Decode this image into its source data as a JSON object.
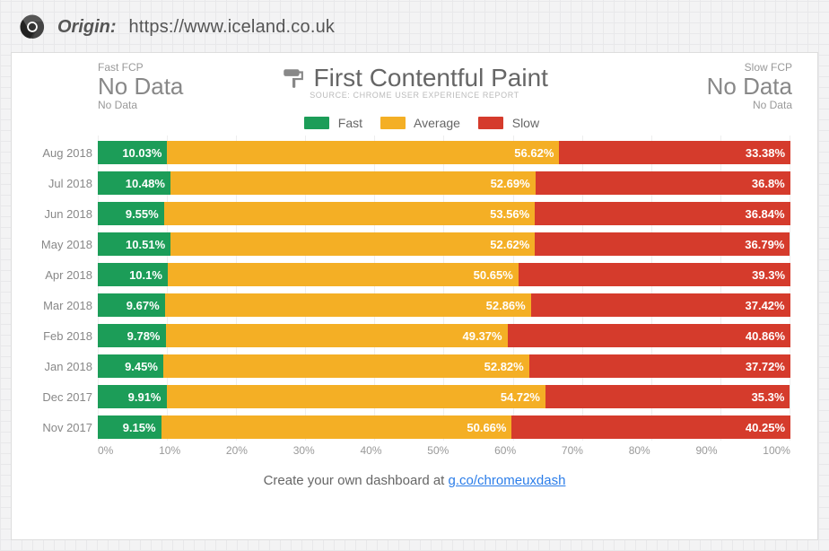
{
  "header": {
    "origin_label": "Origin:",
    "origin_url": "https://www.iceland.co.uk"
  },
  "summary": {
    "fast_label": "Fast FCP",
    "fast_value": "No Data",
    "fast_sub": "No Data",
    "slow_label": "Slow FCP",
    "slow_value": "No Data",
    "slow_sub": "No Data"
  },
  "chart": {
    "title": "First Contentful Paint",
    "source": "SOURCE: CHROME USER EXPERIENCE REPORT",
    "legend": {
      "fast": "Fast",
      "avg": "Average",
      "slow": "Slow"
    }
  },
  "axis": {
    "ticks": [
      "0%",
      "10%",
      "20%",
      "30%",
      "40%",
      "50%",
      "60%",
      "70%",
      "80%",
      "90%",
      "100%"
    ]
  },
  "footer": {
    "text": "Create your own dashboard at ",
    "link_text": "g.co/chromeuxdash"
  },
  "colors": {
    "fast": "#1c9d58",
    "avg": "#f4af25",
    "slow": "#d53b2c"
  },
  "chart_data": {
    "type": "bar",
    "orientation": "horizontal",
    "stacked": true,
    "xlim": [
      0,
      100
    ],
    "xlabel": "",
    "ylabel": "",
    "title": "First Contentful Paint",
    "categories": [
      "Aug 2018",
      "Jul 2018",
      "Jun 2018",
      "May 2018",
      "Apr 2018",
      "Mar 2018",
      "Feb 2018",
      "Jan 2018",
      "Dec 2017",
      "Nov 2017"
    ],
    "series": [
      {
        "name": "Fast",
        "color": "#1c9d58",
        "values": [
          10.03,
          10.48,
          9.55,
          10.51,
          10.1,
          9.67,
          9.78,
          9.45,
          9.91,
          9.15
        ]
      },
      {
        "name": "Average",
        "color": "#f4af25",
        "values": [
          56.62,
          52.69,
          53.56,
          52.62,
          50.65,
          52.86,
          49.37,
          52.82,
          54.72,
          50.66
        ]
      },
      {
        "name": "Slow",
        "color": "#d53b2c",
        "values": [
          33.38,
          36.8,
          36.84,
          36.79,
          39.3,
          37.42,
          40.86,
          37.72,
          35.3,
          40.25
        ]
      }
    ],
    "value_labels": {
      "fast": [
        "10.03%",
        "10.48%",
        "9.55%",
        "10.51%",
        "10.1%",
        "9.67%",
        "9.78%",
        "9.45%",
        "9.91%",
        "9.15%"
      ],
      "avg": [
        "56.62%",
        "52.69%",
        "53.56%",
        "52.62%",
        "50.65%",
        "52.86%",
        "49.37%",
        "52.82%",
        "54.72%",
        "50.66%"
      ],
      "slow": [
        "33.38%",
        "36.8%",
        "36.84%",
        "36.79%",
        "39.3%",
        "37.42%",
        "40.86%",
        "37.72%",
        "35.3%",
        "40.25%"
      ]
    }
  }
}
